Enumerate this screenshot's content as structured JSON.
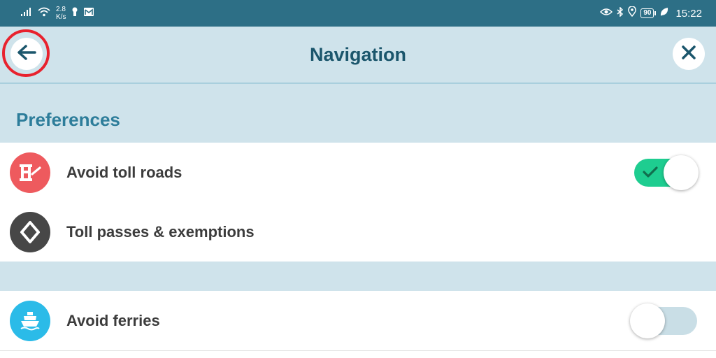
{
  "status_bar": {
    "net_speed_value": "2.8",
    "net_speed_unit": "K/s",
    "battery": "90",
    "time": "15:22"
  },
  "header": {
    "title": "Navigation"
  },
  "section": {
    "title": "Preferences"
  },
  "rows": [
    {
      "label": "Avoid toll roads",
      "icon": "toll-gate-icon",
      "icon_color": "#ee5a5e",
      "toggle": true,
      "toggle_on": true
    },
    {
      "label": "Toll passes & exemptions",
      "icon": "toll-pass-diamond-icon",
      "icon_color": "#474747",
      "toggle": false
    },
    {
      "label": "Avoid ferries",
      "icon": "ferry-icon",
      "icon_color": "#2bbbe8",
      "toggle": true,
      "toggle_on": false
    }
  ],
  "colors": {
    "status_bar": "#2d6f86",
    "header_bg": "#cfe3eb",
    "title": "#1b566c",
    "section_title": "#2d7d9a",
    "toggle_on": "#1ecd90",
    "toggle_off": "#c9dee6",
    "highlight_ring": "#e8222e"
  }
}
